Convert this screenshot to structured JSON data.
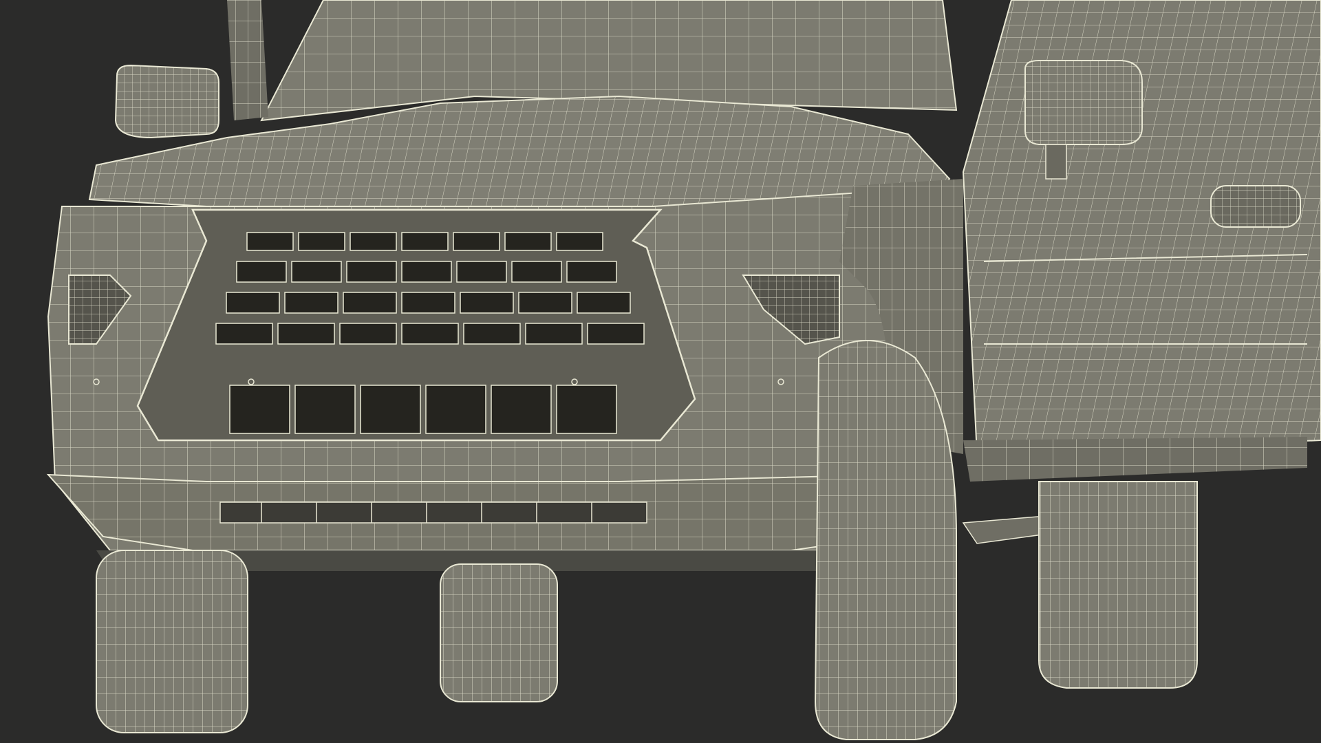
{
  "scene": {
    "subject": "wireframe-suv-front",
    "colors": {
      "background": "#2b2b2a",
      "body_fill": "#7c7b70",
      "body_fill_dark": "#6a695f",
      "wire": "#e9e8d4",
      "grille_hole": "#25241f",
      "shadow": "#4a4a44"
    }
  }
}
